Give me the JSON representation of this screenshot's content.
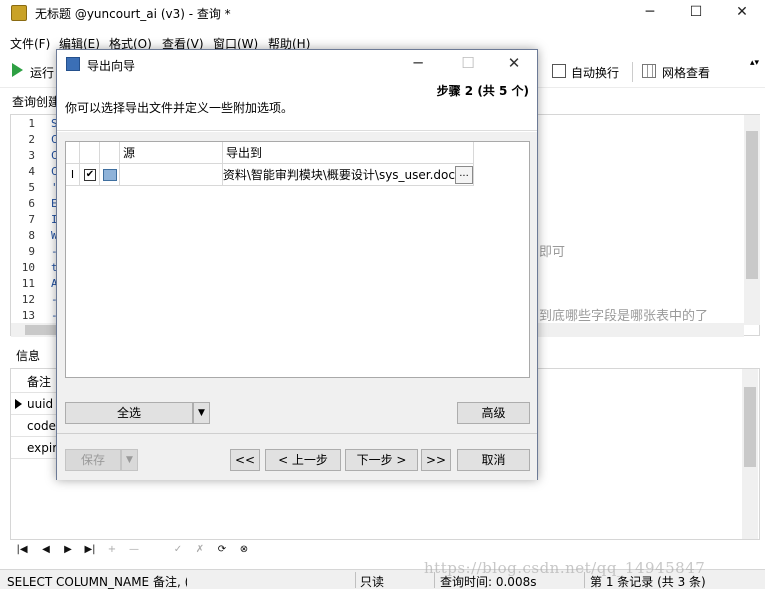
{
  "window": {
    "title": "无标题 @yuncourt_ai (v3) - 查询 *",
    "controls": [
      "─",
      "☐",
      "✕"
    ]
  },
  "menu": [
    "文件(F)",
    "编辑(E)",
    "格式(O)",
    "查看(V)",
    "窗口(W)",
    "帮助(H)"
  ],
  "toolbar": {
    "run_label": "运行",
    "auto_wrap_label": "自动换行",
    "grid_view_label": "网格查看"
  },
  "querybar": {
    "label": "查询创建"
  },
  "editor": {
    "line_numbers": [
      "1",
      "2",
      "3",
      "4",
      "5",
      "6",
      "7",
      "8",
      "9",
      "10",
      "11",
      "12",
      "13"
    ],
    "first_chars": [
      "S",
      "C",
      "C",
      "C",
      "'",
      "E",
      "I",
      "W",
      "-",
      "t",
      "A",
      "-",
      "-"
    ],
    "ghost_1": "即可",
    "ghost_2": "到底哪些字段是哪张表中的了"
  },
  "info": {
    "tab_label": "信息",
    "rows": [
      "备注",
      "uuid",
      "code",
      "expir"
    ]
  },
  "nav": [
    "|◀",
    "◀",
    "▶",
    "▶|",
    "+",
    "—",
    "✓",
    "✗",
    "⟳",
    "⊗"
  ],
  "status": {
    "sql": "SELECT COLUMN_NAME 备注, (",
    "mode": "只读",
    "query_time": "查询时间: 0.008s",
    "record": "第 1 条记录 (共 3 条)"
  },
  "watermark": "https://blog.csdn.net/qq_14945847",
  "dialog": {
    "title": "导出向导",
    "step": "步骤 2 (共 5 个)",
    "description": "你可以选择导出文件并定义一些附加选项。",
    "grid": {
      "headers": [
        "源",
        "导出到"
      ],
      "row": {
        "source": "",
        "target": "资料\\智能审判模块\\概要设计\\sys_user.doc",
        "checked": true
      }
    },
    "browse_label": "...",
    "select_all_label": "全选",
    "advanced_label": "高级",
    "save_label": "保存",
    "first_label": "<<",
    "prev_label": "< 上一步",
    "next_label": "下一步 >",
    "last_label": ">>",
    "cancel_label": "取消"
  }
}
